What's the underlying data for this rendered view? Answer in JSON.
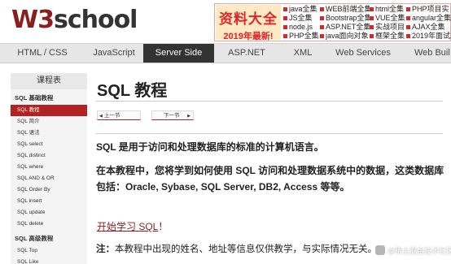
{
  "logo": {
    "w3": "W3",
    "school": "school"
  },
  "ad": {
    "title": "资料大全",
    "subtitle": "2019年最新!",
    "links": [
      "java全集",
      "WEB前端全集",
      "html全集",
      "PHP项目实",
      "JS全集",
      "Bootstrap全集",
      "VUE全集",
      "angular全集",
      "node.js",
      "ASP.NET全集",
      "实战项目",
      "AJAX全集",
      "PHP全集",
      "java面向对象",
      "框架全集",
      "2019年面试题"
    ]
  },
  "nav": {
    "items": [
      "HTML / CSS",
      "JavaScript",
      "Server Side",
      "ASP.NET",
      "XML",
      "Web Services",
      "Web Buil"
    ],
    "active": "Server Side"
  },
  "sidebar": {
    "header": "课程表",
    "sections": [
      {
        "title": "SQL 基础教程",
        "items": [
          "SQL 教程",
          "SQL 简介",
          "SQL 语法",
          "SQL select",
          "SQL distinct",
          "SQL where",
          "SQL AND & OR",
          "SQL Order By",
          "SQL insert",
          "SQL update",
          "SQL delete"
        ]
      },
      {
        "title": "SQL 高级教程",
        "items": [
          "SQL Top",
          "SQL Like"
        ]
      }
    ],
    "active_item": "SQL 教程"
  },
  "main": {
    "title": "SQL 教程",
    "prev_label": "上一节",
    "next_label": "下一节",
    "intro": "SQL 是用于访问和处理数据库的标准的计算机语言。",
    "body": "在本教程中，您将学到如何使用 SQL 访问和处理数据系统中的数据，这类数据库包括：Oracle, Sybase, SQL Server, DB2, Access 等等。",
    "start_link": "开始学习 SQL",
    "start_suffix": "！",
    "note_label": "注：",
    "note_text": "本教程中出现的姓名、地址等信息仅供教学，与实际情况无关。"
  },
  "watermark": {
    "text": "@稀土掘金技术社区"
  },
  "colors": {
    "brand": "#8a1f1f",
    "active_nav": "#333333",
    "active_side": "#b22222",
    "ad_red": "#d9262b"
  }
}
